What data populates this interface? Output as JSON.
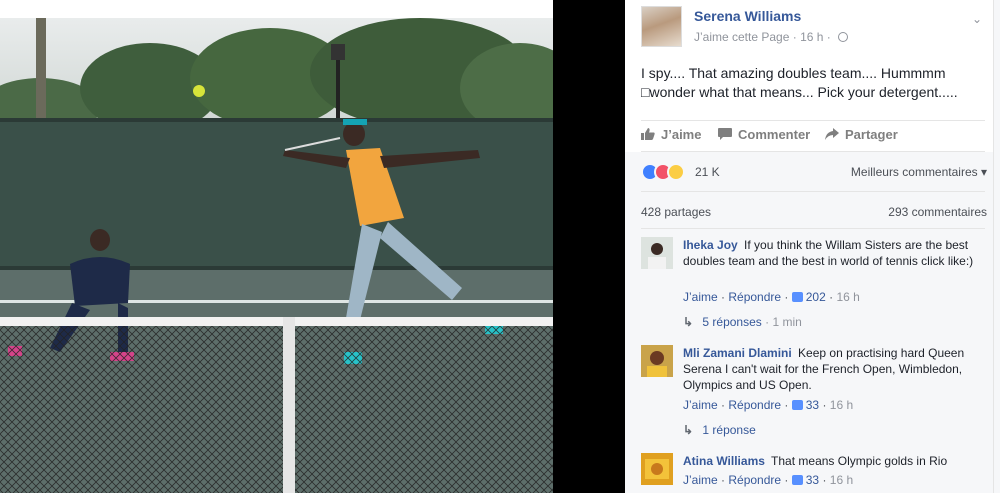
{
  "page": {
    "name": "Serena Williams",
    "like_page": "J’aime cette Page",
    "time": "16 h",
    "separator": "·"
  },
  "post": {
    "text": "I spy.... That amazing doubles team.... Hummmm □wonder what that means... Pick your detergent....."
  },
  "actions": {
    "like": "J’aime",
    "comment": "Commenter",
    "share": "Partager"
  },
  "stats": {
    "reactions": "21 K",
    "sort": "Meilleurs commentaires",
    "sort_arrow": "▾",
    "shares": "428 partages",
    "comments": "293 commentaires"
  },
  "comments": [
    {
      "author": "Iheka Joy",
      "text": "If you think the Willam Sisters are the best doubles team and the best in world of tennis click like:)",
      "like": "J’aime",
      "reply": "Répondre",
      "likes": "202",
      "time": "16 h",
      "replies": "5 réponses",
      "replies_time": "1 min"
    },
    {
      "author": "Mli Zamani Dlamini",
      "text": "Keep on practising hard Queen Serena I can't wait for the French Open, Wimbledon, Olympics and US Open.",
      "like": "J’aime",
      "reply": "Répondre",
      "likes": "33",
      "time": "16 h",
      "replies": "1 réponse",
      "replies_time": ""
    },
    {
      "author": "Atina Williams",
      "text": "That means Olympic golds in Rio",
      "like": "J’aime",
      "reply": "Répondre",
      "likes": "33",
      "time": "16 h"
    }
  ],
  "colors": {
    "link": "#365899",
    "meta": "#90949c",
    "reaction_like": "#4080ff",
    "reaction_love": "#f25268",
    "reaction_haha": "#fbcd44"
  },
  "icons": {
    "like": "thumbs-up-icon",
    "comment": "speech-bubble-icon",
    "share": "share-arrow-icon",
    "audience": "globe-icon",
    "options": "chevron-down-icon",
    "reply": "reply-arrow-icon"
  }
}
